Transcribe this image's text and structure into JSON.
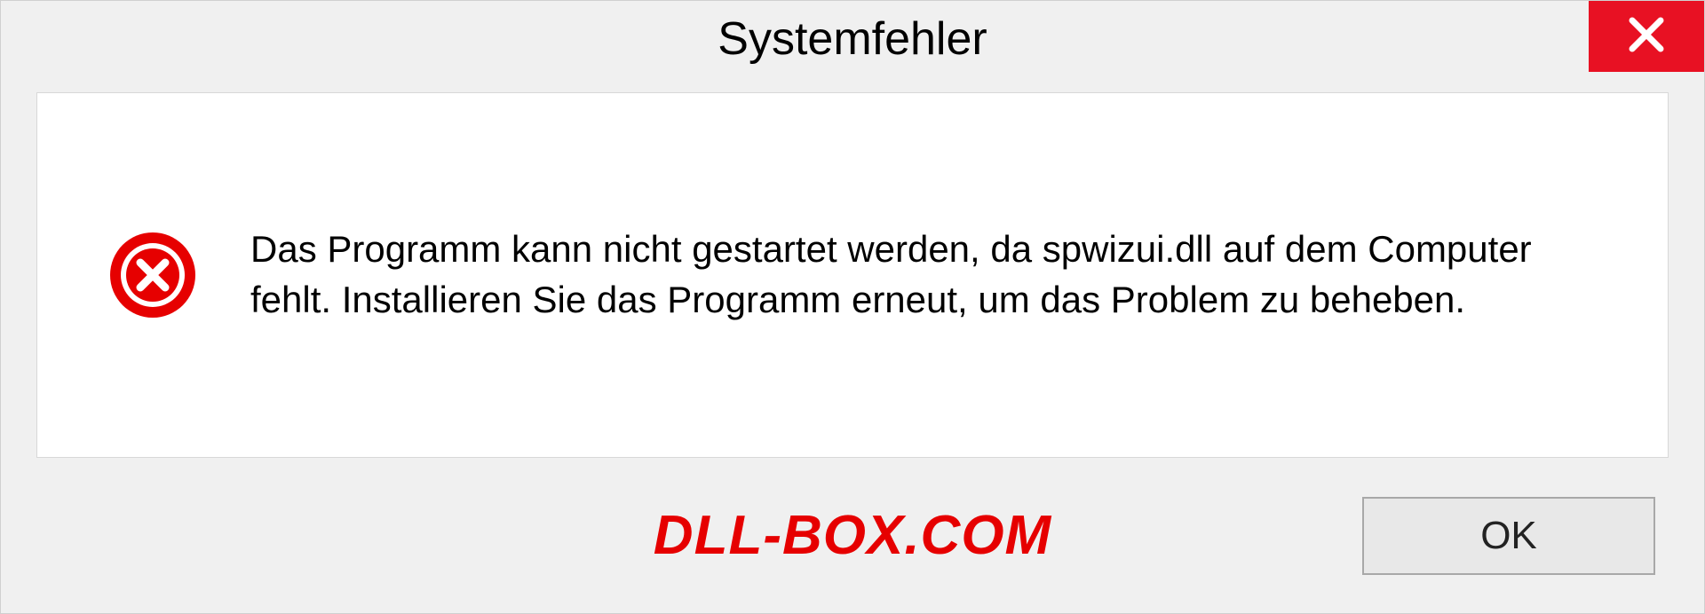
{
  "dialog": {
    "title": "Systemfehler",
    "message": "Das Programm kann nicht gestartet werden, da spwizui.dll auf dem Computer fehlt. Installieren Sie das Programm erneut, um das Problem zu beheben.",
    "ok_label": "OK"
  },
  "watermark": "DLL-BOX.COM",
  "icons": {
    "close": "close-icon",
    "error": "error-icon"
  }
}
